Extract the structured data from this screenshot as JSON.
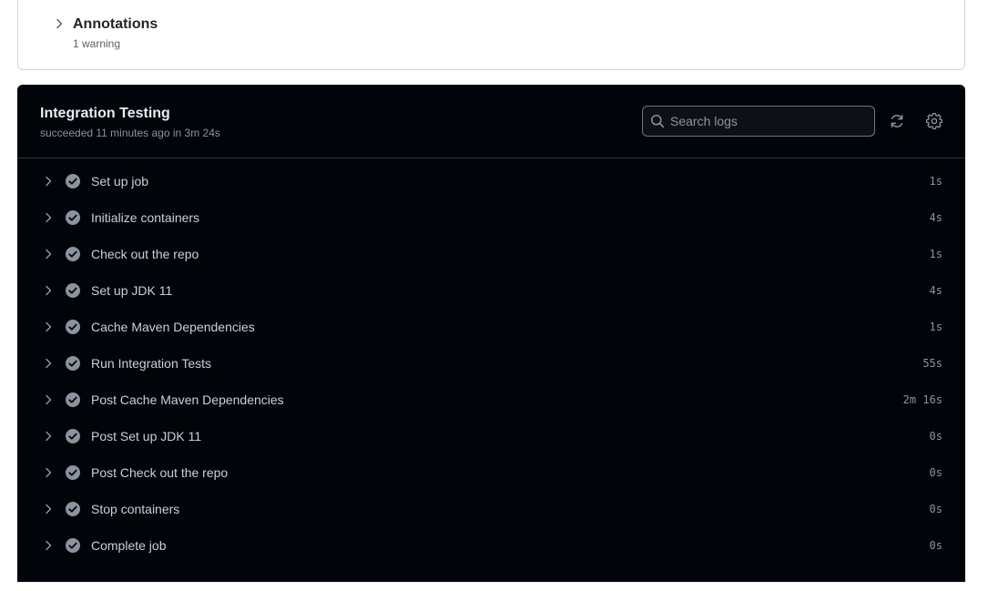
{
  "annotations": {
    "title": "Annotations",
    "summary": "1 warning"
  },
  "job": {
    "title": "Integration Testing",
    "status": "succeeded 11 minutes ago in 3m 24s"
  },
  "search": {
    "placeholder": "Search logs",
    "value": ""
  },
  "icons": {
    "expand": "chevron-right-icon",
    "step_status": "check-circle-icon",
    "search": "search-icon",
    "refresh": "refresh-icon",
    "settings": "gear-icon"
  },
  "colors": {
    "panel_bg": "#010409",
    "step_success": "#8b949e"
  },
  "steps": [
    {
      "name": "Set up job",
      "duration": "1s"
    },
    {
      "name": "Initialize containers",
      "duration": "4s"
    },
    {
      "name": "Check out the repo",
      "duration": "1s"
    },
    {
      "name": "Set up JDK 11",
      "duration": "4s"
    },
    {
      "name": "Cache Maven Dependencies",
      "duration": "1s"
    },
    {
      "name": "Run Integration Tests",
      "duration": "55s"
    },
    {
      "name": "Post Cache Maven Dependencies",
      "duration": "2m 16s"
    },
    {
      "name": "Post Set up JDK 11",
      "duration": "0s"
    },
    {
      "name": "Post Check out the repo",
      "duration": "0s"
    },
    {
      "name": "Stop containers",
      "duration": "0s"
    },
    {
      "name": "Complete job",
      "duration": "0s"
    }
  ]
}
